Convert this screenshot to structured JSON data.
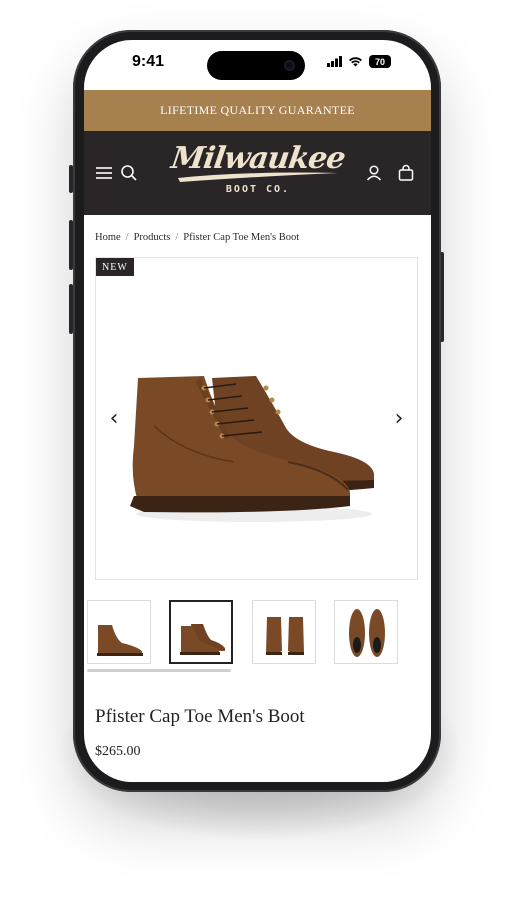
{
  "status_bar": {
    "time": "9:41",
    "battery": "70",
    "icons": [
      "signal-icon",
      "wifi-icon",
      "battery-icon"
    ]
  },
  "promo_banner": {
    "text": "LIFETIME QUALITY GUARANTEE",
    "color": "#a7804f"
  },
  "header": {
    "background": "#2a2526",
    "logo": {
      "script": "Milwaukee",
      "sub": "BOOT CO."
    },
    "icons": [
      "menu-icon",
      "search-icon",
      "account-icon",
      "cart-icon"
    ]
  },
  "breadcrumb": {
    "items": [
      "Home",
      "Products",
      "Pfister Cap Toe Men's Boot"
    ],
    "separator": "/"
  },
  "gallery": {
    "badge": "NEW",
    "prev": "‹",
    "next": "›",
    "thumbnails": [
      "boot-side-left",
      "boot-pair-angle",
      "boot-front-pair",
      "boot-top-pair"
    ],
    "active_thumbnail": 1
  },
  "product": {
    "title": "Pfister Cap Toe Men's Boot",
    "price": "$265.00",
    "leather_color": "#7a4a27"
  }
}
